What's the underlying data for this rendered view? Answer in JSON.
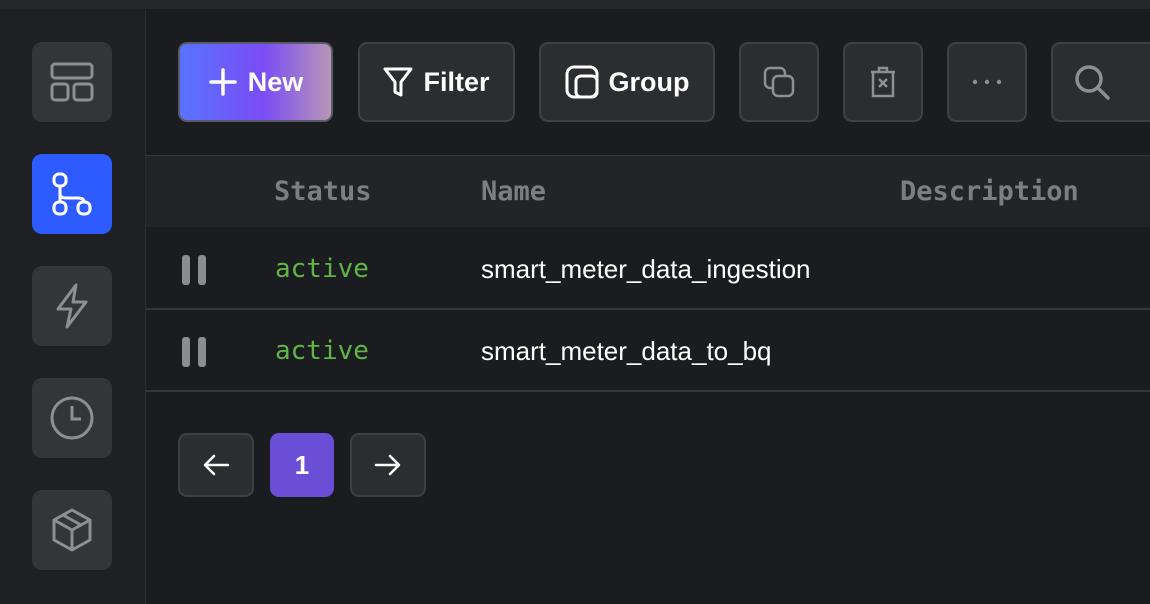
{
  "toolbar": {
    "new_label": "New",
    "filter_label": "Filter",
    "group_label": "Group"
  },
  "sidebar": {
    "items": [
      {
        "icon": "layout-icon",
        "active": false
      },
      {
        "icon": "pipeline-icon",
        "active": true
      },
      {
        "icon": "lightning-icon",
        "active": false
      },
      {
        "icon": "clock-icon",
        "active": false
      },
      {
        "icon": "cube-icon",
        "active": false
      }
    ]
  },
  "table": {
    "columns": [
      "Status",
      "Name",
      "Description"
    ],
    "rows": [
      {
        "status": "active",
        "name": "smart_meter_data_ingestion",
        "description": ""
      },
      {
        "status": "active",
        "name": "smart_meter_data_to_bq",
        "description": ""
      }
    ]
  },
  "pagination": {
    "current_page": "1"
  },
  "colors": {
    "accent": "#2e5bff",
    "status_active": "#5fb545",
    "page_current": "#6a4fd6"
  }
}
